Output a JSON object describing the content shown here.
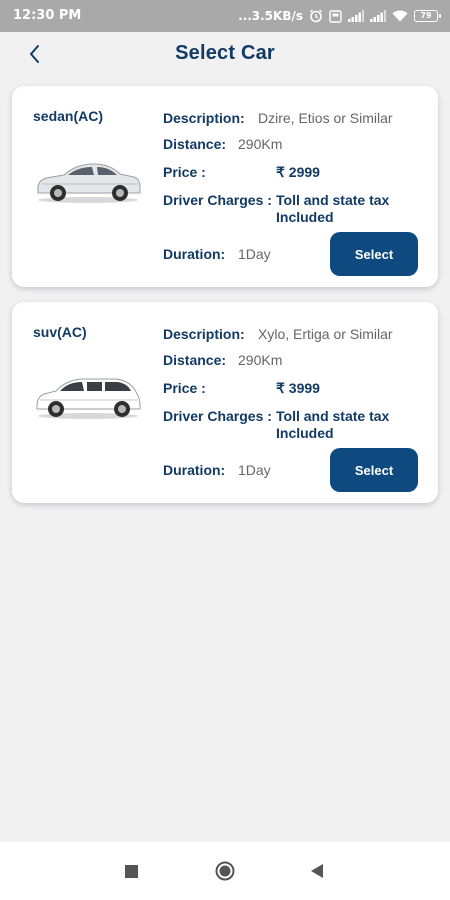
{
  "status_bar": {
    "time": "12:30 PM",
    "network_speed": "...3.5KB/s",
    "battery_level": "79",
    "icons": [
      "alarm-icon",
      "storage-icon",
      "signal-icon",
      "signal-icon",
      "wifi-icon",
      "battery-icon"
    ]
  },
  "header": {
    "title": "Select Car",
    "back_icon": "chevron-left-icon"
  },
  "labels": {
    "description": "Description:",
    "distance": "Distance:",
    "price": "Price :",
    "driver_charges": "Driver Charges :",
    "duration": "Duration:"
  },
  "cars": [
    {
      "type": "sedan(AC)",
      "description": "Dzire, Etios or Similar",
      "distance": "290Km",
      "price": "₹ 2999",
      "driver_charges": "Toll and state tax Included",
      "duration": "1Day",
      "select_label": "Select",
      "image": "sedan-car-image"
    },
    {
      "type": "suv(AC)",
      "description": "Xylo, Ertiga or Similar",
      "distance": "290Km",
      "price": "₹ 3999",
      "driver_charges": "Toll and state tax Included",
      "duration": "1Day",
      "select_label": "Select",
      "image": "suv-car-image"
    }
  ],
  "colors": {
    "primary": "#123a64",
    "button": "#0e4a80",
    "background": "#f1f1f2",
    "status_bar": "#a9a9a9"
  },
  "nav_bar": {
    "icons": [
      "recents-icon",
      "home-icon",
      "back-icon"
    ]
  }
}
